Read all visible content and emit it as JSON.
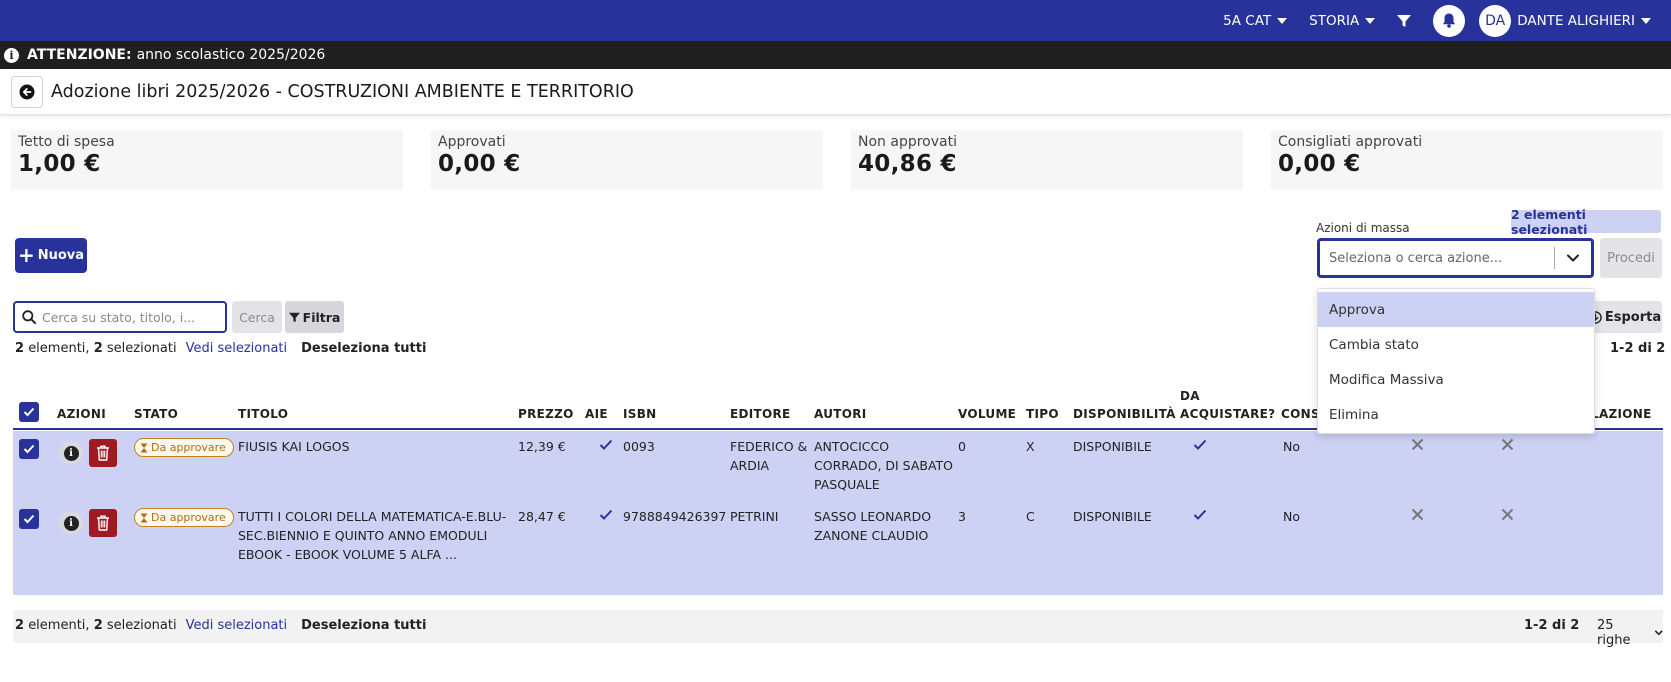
{
  "topbar": {
    "class_label": "5A CAT",
    "subject_label": "STORIA",
    "avatar_initials": "DA",
    "user_name": "DANTE ALIGHIERI",
    "bg_color": "#27339a"
  },
  "alert": {
    "label": "ATTENZIONE:",
    "text": "anno scolastico 2025/2026"
  },
  "page": {
    "title": "Adozione libri 2025/2026 - COSTRUZIONI AMBIENTE E TERRITORIO"
  },
  "cards": [
    {
      "label": "Tetto di spesa",
      "value": "1,00 €"
    },
    {
      "label": "Approvati",
      "value": "0,00 €"
    },
    {
      "label": "Non approvati",
      "value": "40,86 €"
    },
    {
      "label": "Consigliati approvati",
      "value": "0,00 €"
    }
  ],
  "toolbar": {
    "new_label": "Nuova",
    "mass_actions_label": "Azioni di massa",
    "selected_badge": "2 elementi selezionati",
    "mass_select_placeholder": "Seleziona o cerca azione...",
    "proceed_label": "Procedi",
    "search_placeholder": "Cerca su stato, titolo, i...",
    "search_label": "Cerca",
    "filter_label": "Filtra",
    "export_label": "Esporta"
  },
  "mass_actions": [
    {
      "label": "Approva",
      "active": true
    },
    {
      "label": "Cambia stato"
    },
    {
      "label": "Modifica Massiva"
    },
    {
      "label": "Elimina"
    }
  ],
  "summary": {
    "count": "2",
    "count_text": "elementi,",
    "selected": "2",
    "selected_text": "selezionati",
    "view_selected": "Vedi selezionati",
    "deselect_all": "Deseleziona tutti",
    "pager": "1-2 di 2"
  },
  "table": {
    "headers": {
      "azioni": "AZIONI",
      "stato": "STATO",
      "titolo": "TITOLO",
      "prezzo": "PREZZO",
      "aie": "AIE",
      "isbn": "ISBN",
      "editore": "EDITORE",
      "autori": "AUTORI",
      "volume": "VOLUME",
      "tipo": "TIPO",
      "disponibilita": "DISPONIBILITÀ",
      "da_acquistare_1": "DA",
      "da_acquistare_2": "ACQUISTARE?",
      "cons": "CONS",
      "lazione": "LAZIONE"
    },
    "rows": [
      {
        "stato": "Da approvare",
        "titolo": "FIUSIS KAI LOGOS",
        "prezzo": "12,39 €",
        "isbn": "0093",
        "editore": "FEDERICO & ARDIA",
        "autori": "ANTOCICCO CORRADO, DI SABATO PASQUALE",
        "volume": "0",
        "tipo": "X",
        "disponibilita": "DISPONIBILE",
        "consigliato": "No"
      },
      {
        "stato": "Da approvare",
        "titolo": "TUTTI I COLORI DELLA MATEMATICA-E.BLU-SEC.BIENNIO E QUINTO ANNO EMODULI EBOOK - EBOOK VOLUME 5 ALFA ...",
        "prezzo": "28,47 €",
        "isbn": "9788849426397",
        "editore": "PETRINI",
        "autori": "SASSO LEONARDO ZANONE CLAUDIO",
        "volume": "3",
        "tipo": "C",
        "disponibilita": "DISPONIBILE",
        "consigliato": "No"
      }
    ]
  },
  "footer": {
    "rows_per_page": "25 righe"
  },
  "colors": {
    "primary": "#27339a",
    "selected_row": "#cdd2f5",
    "delete": "#9e1b24",
    "status_badge": "#c7801e"
  }
}
